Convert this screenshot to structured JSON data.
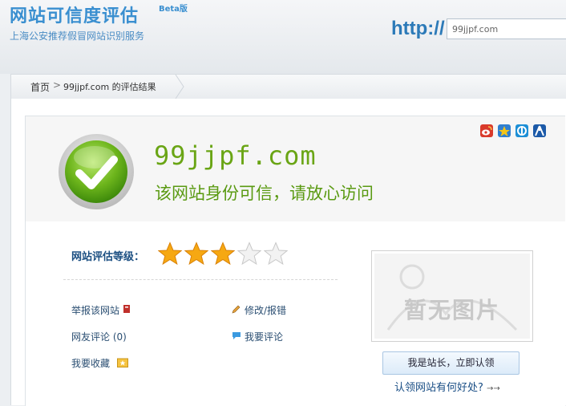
{
  "header": {
    "site_title": "网站可信度评估",
    "beta": "Beta版",
    "subtitle": "上海公安推荐假冒网站识别服务",
    "http_label": "http://",
    "url_value": "99jjpf.com"
  },
  "breadcrumb": {
    "home": "首页",
    "separator": ">",
    "current": "99jjpf.com 的评估结果"
  },
  "result": {
    "domain": "99jjpf.com",
    "verdict": "该网站身份可信，请放心访问",
    "status_color": "#6aa515"
  },
  "share_icons": [
    "weibo-icon",
    "qzone-icon",
    "pengyou-icon",
    "renren-icon"
  ],
  "rating": {
    "label": "网站评估等级：",
    "stars_filled": 3,
    "stars_total": 5
  },
  "actions": {
    "report": "举报该网站",
    "edit": "修改/报错",
    "comments": "网友评论 (0)",
    "write_comment": "我要评论",
    "favorite": "我要收藏"
  },
  "screenshot": {
    "placeholder": "暂无图片"
  },
  "claim": {
    "button": "我是站长，立即认领",
    "link": "认领网站有何好处?",
    "link_arrow": "→→"
  }
}
